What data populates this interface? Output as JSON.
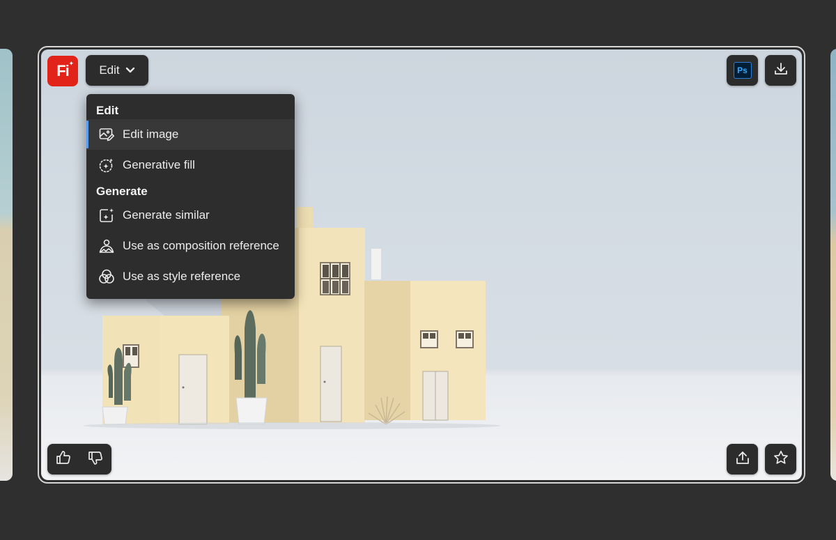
{
  "app": {
    "logo_text": "Fi",
    "logo_color": "#e1231a"
  },
  "toolbar": {
    "edit_label": "Edit",
    "ps_label": "Ps",
    "icons": [
      "chevron-down-icon",
      "photoshop-icon",
      "download-icon",
      "thumbs-up-icon",
      "thumbs-down-icon",
      "share-icon",
      "star-icon"
    ]
  },
  "menu": {
    "sections": [
      {
        "heading": "Edit",
        "items": [
          {
            "label": "Edit image",
            "icon": "edit-image-icon",
            "active": true
          },
          {
            "label": "Generative fill",
            "icon": "generative-fill-icon"
          }
        ]
      },
      {
        "heading": "Generate",
        "items": [
          {
            "label": "Generate similar",
            "icon": "generate-similar-icon"
          },
          {
            "label": "Use as composition reference",
            "icon": "composition-reference-icon"
          },
          {
            "label": "Use as style reference",
            "icon": "style-reference-icon"
          }
        ]
      }
    ],
    "active_indicator_color": "#5a9ef0"
  },
  "colors": {
    "background": "#2f2f2f",
    "button_bg": "#2c2c2c",
    "menu_bg": "#2d2d2d"
  }
}
